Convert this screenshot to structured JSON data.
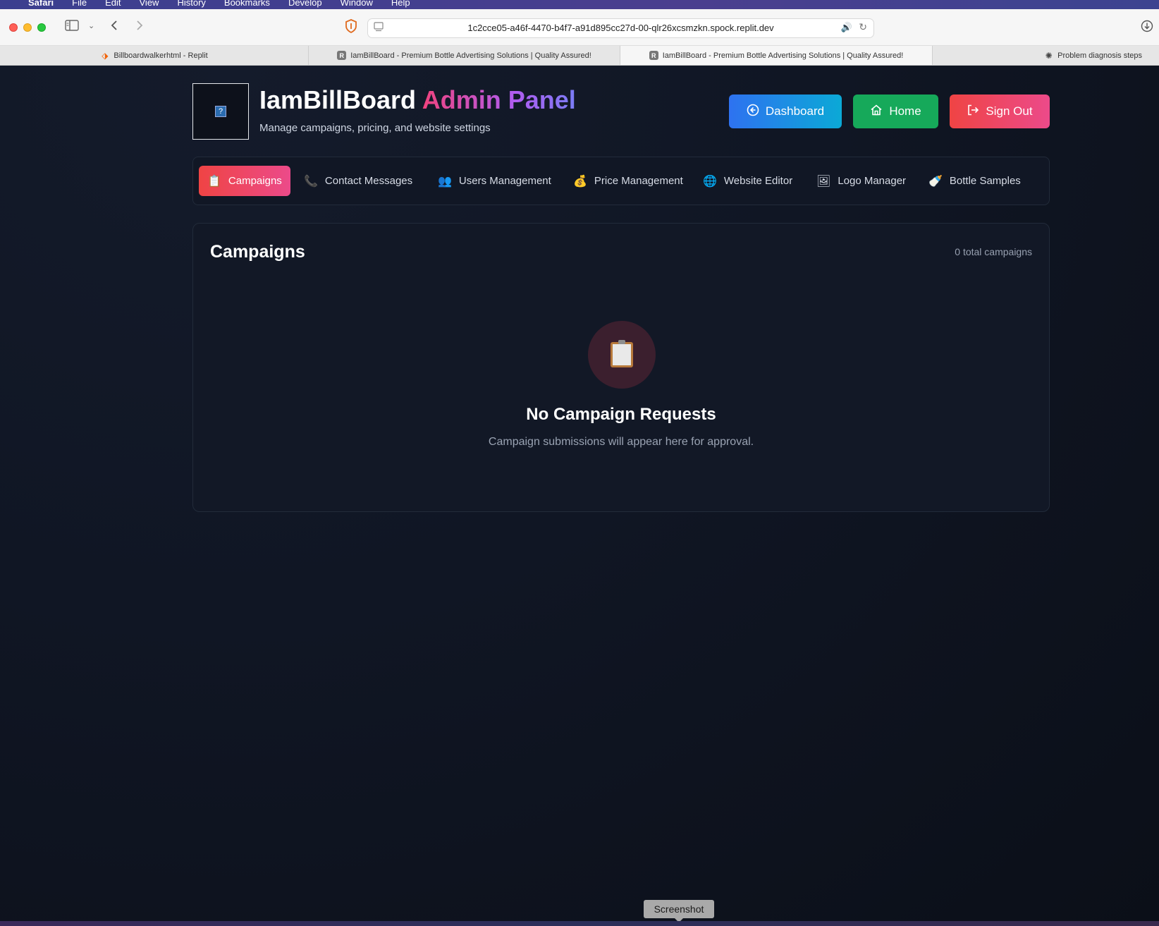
{
  "menubar": {
    "app": "Safari",
    "items": [
      "File",
      "Edit",
      "View",
      "History",
      "Bookmarks",
      "Develop",
      "Window",
      "Help"
    ]
  },
  "browser": {
    "url": "1c2cce05-a46f-4470-b4f7-a91d895cc27d-00-qlr26xcsmzkn.spock.replit.dev",
    "tabs": [
      {
        "title": "Billboardwalkerhtml - Replit",
        "favicon": "replit-icon",
        "active": false
      },
      {
        "title": "IamBillBoard - Premium Bottle Advertising Solutions | Quality Assured!",
        "favicon": "R",
        "active": false
      },
      {
        "title": "IamBillBoard - Premium Bottle Advertising Solutions | Quality Assured!",
        "favicon": "R",
        "active": true
      },
      {
        "title": "Problem diagnosis steps",
        "favicon": "chatgpt-icon",
        "active": false
      }
    ]
  },
  "header": {
    "brand": "IamBillBoard",
    "brand_accent": "Admin Panel",
    "subtitle": "Manage campaigns, pricing, and website settings",
    "buttons": {
      "dashboard": "Dashboard",
      "home": "Home",
      "sign_out": "Sign Out"
    }
  },
  "nav": {
    "items": [
      {
        "label": "Campaigns",
        "icon": "📋",
        "active": true
      },
      {
        "label": "Contact Messages",
        "icon": "📞",
        "active": false
      },
      {
        "label": "Users Management",
        "icon": "👥",
        "active": false
      },
      {
        "label": "Price Management",
        "icon": "💰",
        "active": false
      },
      {
        "label": "Website Editor",
        "icon": "🌐",
        "active": false
      },
      {
        "label": "Logo Manager",
        "icon": "🖼",
        "active": false
      },
      {
        "label": "Bottle Samples",
        "icon": "🍼",
        "active": false
      }
    ]
  },
  "campaigns": {
    "title": "Campaigns",
    "count_text": "0 total campaigns",
    "empty_title": "No Campaign Requests",
    "empty_subtitle": "Campaign submissions will appear here for approval."
  },
  "overlay": {
    "screenshot_tooltip": "Screenshot"
  },
  "colors": {
    "page_bg": "#0d111b",
    "active_tab": "#ef4444",
    "dashboard_btn": "#2e72f0",
    "home_btn": "#16a95a",
    "signout_btn": "#ef4444"
  }
}
